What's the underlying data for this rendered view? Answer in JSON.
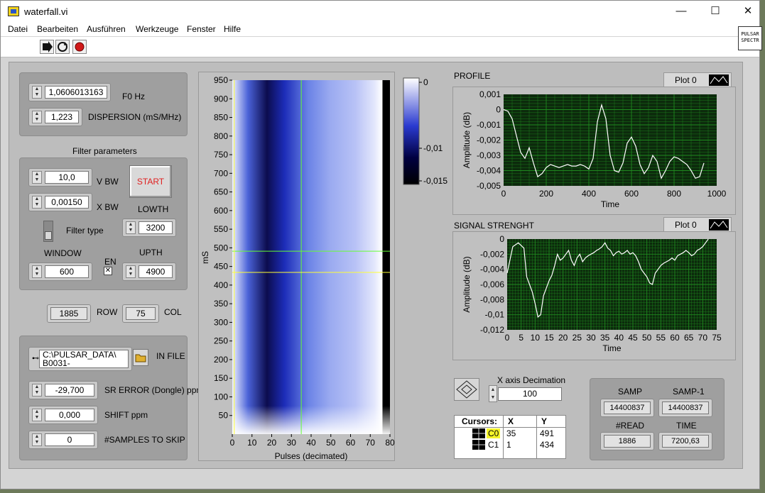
{
  "window": {
    "title": "waterfall.vi",
    "minimize": "—",
    "maximize": "☐",
    "close": "✕"
  },
  "menu": [
    "Datei",
    "Bearbeiten",
    "Ausführen",
    "Werkzeuge",
    "Fenster",
    "Hilfe"
  ],
  "toolbar": {
    "run": "run-arrow-icon",
    "run_continuous": "run-continuously-icon",
    "abort": "abort-stop-icon"
  },
  "vi_icon_text": [
    "PULSAR",
    "SPECTR"
  ],
  "controls": {
    "f0": {
      "value": "1,0606013163",
      "label": "F0 Hz"
    },
    "dispersion": {
      "value": "1,223",
      "label": "DISPERSION (mS/MHz)"
    },
    "filter_title": "Filter parameters",
    "vbw": {
      "value": "10,0",
      "label": "V BW"
    },
    "xbw": {
      "value": "0,00150",
      "label": "X BW"
    },
    "start": "START",
    "filter_type": "Filter type",
    "lowth": {
      "value": "3200",
      "label": "LOWTH"
    },
    "upth": {
      "value": "4900",
      "label": "UPTH"
    },
    "window": {
      "value": "600",
      "label": "WINDOW"
    },
    "en": {
      "label": "EN",
      "checked": true
    },
    "row": {
      "value": "1885",
      "label": "ROW"
    },
    "col": {
      "value": "75",
      "label": "COL"
    },
    "infile": {
      "line1": "C:\\PULSAR_DATA\\",
      "line2": "B0031-",
      "label": "IN FILE"
    },
    "sr_error": {
      "value": "-29,700",
      "label": "SR ERROR (Dongle) ppm"
    },
    "shift": {
      "value": "0,000",
      "label": "SHIFT ppm"
    },
    "skip": {
      "value": "0",
      "label": "#SAMPLES TO SKIP"
    },
    "x_decimation": {
      "value": "100",
      "label": "X axis Decimation"
    }
  },
  "indicators": {
    "samp": {
      "label": "SAMP",
      "value": "14400837"
    },
    "samp1": {
      "label": "SAMP-1",
      "value": "14400837"
    },
    "read": {
      "label": "#READ",
      "value": "1886"
    },
    "time": {
      "label": "TIME",
      "value": "7200,63"
    }
  },
  "cursors": {
    "headers": [
      "Cursors:",
      "X",
      "Y"
    ],
    "rows": [
      {
        "name": "C0",
        "x": "35",
        "y": "491"
      },
      {
        "name": "C1",
        "x": "1",
        "y": "434"
      }
    ]
  },
  "colors": {
    "accent": "#e02020",
    "plot_bg": "#0c2a0c",
    "grid": "#1f8a1f"
  },
  "chart_data": [
    {
      "type": "heatmap",
      "xlabel": "Pulses (decimated)",
      "ylabel": "mS",
      "xlim": [
        0,
        80
      ],
      "ylim": [
        0,
        950
      ],
      "x_ticks": [
        0,
        10,
        20,
        30,
        40,
        50,
        60,
        70,
        80
      ],
      "y_ticks": [
        50,
        100,
        150,
        200,
        250,
        300,
        350,
        400,
        450,
        500,
        550,
        600,
        650,
        700,
        750,
        800,
        850,
        900,
        950
      ],
      "colorbar": {
        "ticks": [
          "0",
          "-0,01",
          "-0,015"
        ]
      },
      "cursor_lines": [
        {
          "x": 35,
          "y": 491
        },
        {
          "x": 1,
          "y": 434
        }
      ]
    },
    {
      "type": "line",
      "title": "PROFILE",
      "legend": "Plot 0",
      "xlabel": "Time",
      "ylabel": "Amplitude (dB)",
      "xlim": [
        0,
        1000
      ],
      "ylim": [
        -0.005,
        0.001
      ],
      "x_ticks": [
        "0",
        "200",
        "400",
        "600",
        "800",
        "1000"
      ],
      "y_ticks": [
        "0,001",
        "0",
        "-0,001",
        "-0,002",
        "-0,003",
        "-0,004",
        "-0,005"
      ],
      "x": [
        0,
        20,
        40,
        60,
        80,
        100,
        120,
        140,
        160,
        180,
        200,
        220,
        240,
        260,
        280,
        300,
        320,
        340,
        360,
        380,
        400,
        420,
        440,
        460,
        480,
        500,
        520,
        540,
        560,
        580,
        600,
        620,
        640,
        660,
        680,
        700,
        720,
        740,
        760,
        780,
        800,
        820,
        840,
        860,
        880,
        900,
        920,
        940
      ],
      "y": [
        0,
        -0.0001,
        -0.0006,
        -0.0017,
        -0.0028,
        -0.0032,
        -0.0025,
        -0.0035,
        -0.0044,
        -0.0042,
        -0.0038,
        -0.0036,
        -0.0037,
        -0.0038,
        -0.0037,
        -0.0036,
        -0.0037,
        -0.0037,
        -0.0036,
        -0.0037,
        -0.0039,
        -0.0032,
        -0.0008,
        0.0003,
        -0.0006,
        -0.003,
        -0.004,
        -0.0041,
        -0.0035,
        -0.0022,
        -0.0018,
        -0.0024,
        -0.0036,
        -0.0042,
        -0.0038,
        -0.003,
        -0.0034,
        -0.0045,
        -0.004,
        -0.0034,
        -0.0031,
        -0.0032,
        -0.0034,
        -0.0036,
        -0.004,
        -0.0045,
        -0.0044,
        -0.0035
      ],
      "grid": true
    },
    {
      "type": "line",
      "title": "SIGNAL STRENGHT",
      "legend": "Plot 0",
      "xlabel": "Time",
      "ylabel": "Amplitude (dB)",
      "xlim": [
        0,
        75
      ],
      "ylim": [
        -0.012,
        0
      ],
      "x_ticks": [
        "0",
        "5",
        "10",
        "15",
        "20",
        "25",
        "30",
        "35",
        "40",
        "45",
        "50",
        "55",
        "60",
        "65",
        "70",
        "75"
      ],
      "y_ticks": [
        "0",
        "-0,002",
        "-0,004",
        "-0,006",
        "-0,008",
        "-0,01",
        "-0,012"
      ],
      "x": [
        0,
        2,
        4,
        6,
        7,
        8,
        9,
        10,
        11,
        12,
        13,
        14,
        15,
        16,
        17,
        18,
        19,
        20,
        21,
        22,
        23,
        24,
        25,
        26,
        27,
        28,
        29,
        30,
        31,
        32,
        33,
        34,
        35,
        36,
        37,
        38,
        39,
        40,
        41,
        42,
        43,
        44,
        45,
        46,
        47,
        48,
        49,
        50,
        51,
        52,
        53,
        54,
        55,
        56,
        57,
        58,
        59,
        60,
        61,
        62,
        63,
        64,
        65,
        66,
        67,
        68,
        69,
        70,
        71,
        72
      ],
      "y": [
        -0.0045,
        -0.001,
        -0.0005,
        -0.0012,
        -0.005,
        -0.006,
        -0.007,
        -0.0085,
        -0.0103,
        -0.01,
        -0.0075,
        -0.0065,
        -0.0055,
        -0.0048,
        -0.0035,
        -0.002,
        -0.0028,
        -0.0025,
        -0.002,
        -0.0015,
        -0.0028,
        -0.0035,
        -0.0025,
        -0.002,
        -0.003,
        -0.0025,
        -0.0022,
        -0.002,
        -0.0018,
        -0.0015,
        -0.0013,
        -0.001,
        -0.0005,
        -0.0012,
        -0.0015,
        -0.0022,
        -0.0018,
        -0.0016,
        -0.002,
        -0.0018,
        -0.0015,
        -0.002,
        -0.0018,
        -0.0022,
        -0.003,
        -0.004,
        -0.0045,
        -0.005,
        -0.0058,
        -0.006,
        -0.0045,
        -0.004,
        -0.0035,
        -0.0032,
        -0.003,
        -0.0028,
        -0.0025,
        -0.0028,
        -0.0022,
        -0.002,
        -0.0018,
        -0.0015,
        -0.0018,
        -0.0022,
        -0.002,
        -0.0015,
        -0.0013,
        -0.001,
        -0.0005,
        0
      ],
      "grid": true
    }
  ]
}
